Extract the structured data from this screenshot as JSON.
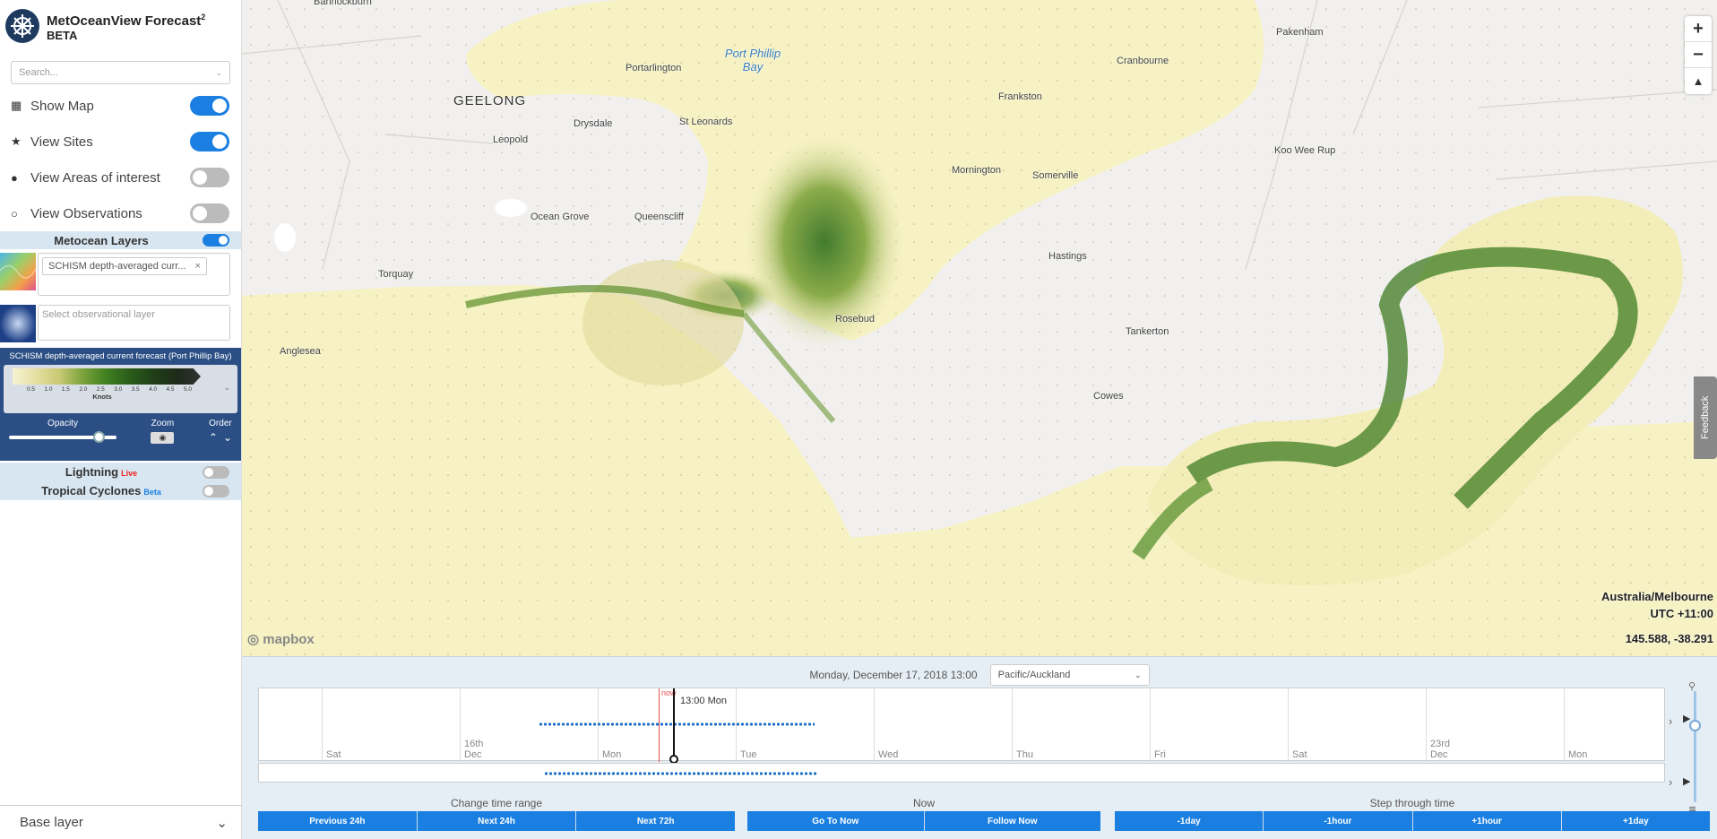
{
  "app": {
    "title": "MetOceanView Forecast",
    "title_sup": "2",
    "beta": "BETA"
  },
  "search": {
    "placeholder": "Search..."
  },
  "toggles": [
    {
      "icon": "grid-icon",
      "glyph": "▦",
      "label": "Show Map",
      "on": true
    },
    {
      "icon": "star-icon",
      "glyph": "★",
      "label": "View Sites",
      "on": true
    },
    {
      "icon": "dot-icon",
      "glyph": "●",
      "label": "View Areas of interest",
      "on": false
    },
    {
      "icon": "circle-icon",
      "glyph": "○",
      "label": "View Observations",
      "on": false
    }
  ],
  "metocean": {
    "title": "Metocean Layers",
    "on": true
  },
  "layers": {
    "forecast_chip": "SCHISM depth-averaged curr...",
    "chip_close": "×",
    "obs_placeholder": "Select observational layer"
  },
  "legend": {
    "title": "SCHISM depth-averaged current forecast (Port Phillip Bay)",
    "ticks": [
      "0.5",
      "1.0",
      "1.5",
      "2.0",
      "2.5",
      "3.0",
      "3.5",
      "4.0",
      "4.5",
      "5.0"
    ],
    "unit": "Knots",
    "opacity_label": "Opacity",
    "zoom_label": "Zoom",
    "order_label": "Order",
    "opacity": 0.83
  },
  "extras": {
    "lightning": "Lightning",
    "lightning_badge": "Live",
    "cyclones": "Tropical Cyclones",
    "cyclones_badge": "Beta"
  },
  "base_layer": {
    "label": "Base layer"
  },
  "map": {
    "places": {
      "bannockburn": "Bannockburn",
      "geelong": "GEELONG",
      "portarlington": "Portarlington",
      "drysdale": "Drysdale",
      "leopold": "Leopold",
      "st_leonards": "St Leonards",
      "ocean_grove": "Ocean Grove",
      "queenscliff": "Queenscliff",
      "torquay": "Torquay",
      "anglesea": "Anglesea",
      "frankston": "Frankston",
      "cranbourne": "Cranbourne",
      "pakenham": "Pakenham",
      "mornington": "Mornington",
      "somerville": "Somerville",
      "koo_wee_rup": "Koo Wee Rup",
      "hastings": "Hastings",
      "rosebud": "Rosebud",
      "tankerton": "Tankerton",
      "cowes": "Cowes",
      "bay": "Port Phillip Bay"
    },
    "timezone": "Australia/Melbourne",
    "utc": "UTC +11:00",
    "coords": "145.588, -38.291",
    "attribution": "mapbox",
    "feedback": "Feedback",
    "zoom_in": "+",
    "zoom_out": "−",
    "compass": "▲"
  },
  "timeline": {
    "current_datetime": "Monday, December 17, 2018 13:00",
    "timezone_select": "Pacific/Auckland",
    "now_label": "now",
    "cursor_label": "13:00 Mon",
    "days": [
      "Sat",
      "16th Dec",
      "Mon",
      "Tue",
      "Wed",
      "Thu",
      "Fri",
      "Sat",
      "23rd Dec",
      "Mon"
    ]
  },
  "controls": {
    "change_range": {
      "title": "Change time range",
      "buttons": [
        "Previous 24h",
        "Next 24h",
        "Next 72h"
      ]
    },
    "now": {
      "title": "Now",
      "buttons": [
        "Go To Now",
        "Follow Now"
      ]
    },
    "step": {
      "title": "Step through time",
      "buttons": [
        "-1day",
        "-1hour",
        "+1hour",
        "+1day"
      ]
    }
  },
  "colors": {
    "accent": "#1a7fe0",
    "panel": "#2b4f85",
    "water": "#f7f3c8",
    "current_strong": "#3f7f20"
  }
}
